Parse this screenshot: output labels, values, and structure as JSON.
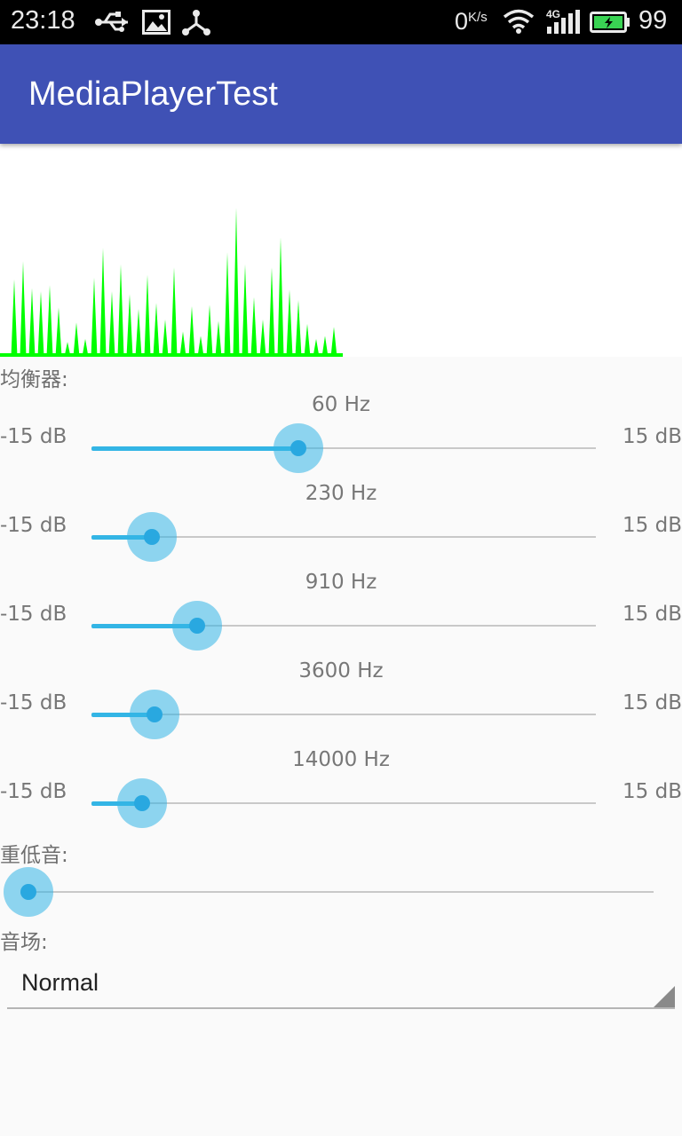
{
  "status_bar": {
    "time": "23:18",
    "net_speed": "0",
    "net_speed_unit": "K/s",
    "network": "4G",
    "battery": "99",
    "icons": [
      "usb-icon",
      "image-icon",
      "share-icon",
      "wifi-icon",
      "signal-icon",
      "battery-charging-icon"
    ]
  },
  "app_bar": {
    "title": "MediaPlayerTest"
  },
  "visualizer": {
    "color": "#00ff00",
    "levels": [
      0.52,
      0.64,
      0.46,
      0.44,
      0.48,
      0.33,
      0.1,
      0.23,
      0.12,
      0.53,
      0.73,
      0.44,
      0.62,
      0.42,
      0.32,
      0.55,
      0.36,
      0.25,
      0.6,
      0.17,
      0.34,
      0.14,
      0.35,
      0.24,
      0.7,
      1.0,
      0.62,
      0.4,
      0.25,
      0.6,
      0.8,
      0.45,
      0.38,
      0.22,
      0.12,
      0.14,
      0.2
    ]
  },
  "equalizer": {
    "label": "均衡器:",
    "min_label": "-15 dB",
    "max_label": "15 dB",
    "bands": [
      {
        "freq": "60 Hz",
        "value": 0.41
      },
      {
        "freq": "230 Hz",
        "value": 0.12
      },
      {
        "freq": "910 Hz",
        "value": 0.21
      },
      {
        "freq": "3600 Hz",
        "value": 0.125
      },
      {
        "freq": "14000 Hz",
        "value": 0.1
      }
    ]
  },
  "bass_boost": {
    "label": "重低音:",
    "value": 0.0
  },
  "reverb": {
    "label": "音场:",
    "selected": "Normal"
  },
  "colors": {
    "accent": "#33b5e5",
    "primary": "#3f51b5"
  }
}
